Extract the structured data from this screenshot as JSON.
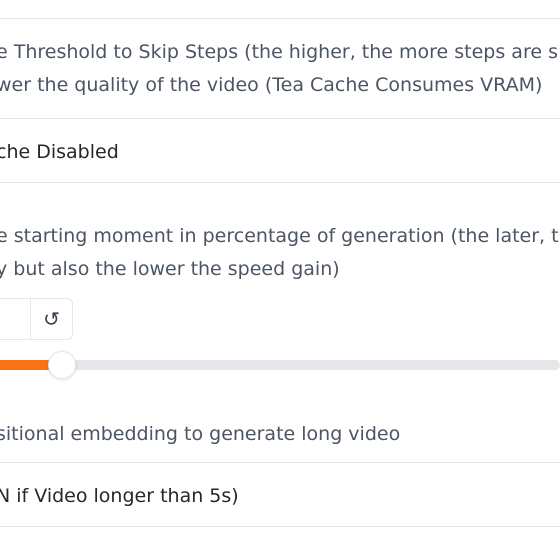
{
  "threshold": {
    "label_line1": "e Threshold to Skip Steps (the higher, the more steps are s",
    "label_line2": "wer the quality of the video (Tea Cache Consumes VRAM)",
    "value": "che Disabled"
  },
  "start_moment": {
    "label_line1": "e starting moment in percentage of generation (the later, t",
    "label_line2": "y but also the lower the speed gain)",
    "reset_icon": "↺",
    "slider_fraction": 0.11
  },
  "positional": {
    "label": "sitional embedding to generate long video",
    "value": "N if Video longer than 5s)"
  },
  "colors": {
    "accent": "#f97316"
  }
}
